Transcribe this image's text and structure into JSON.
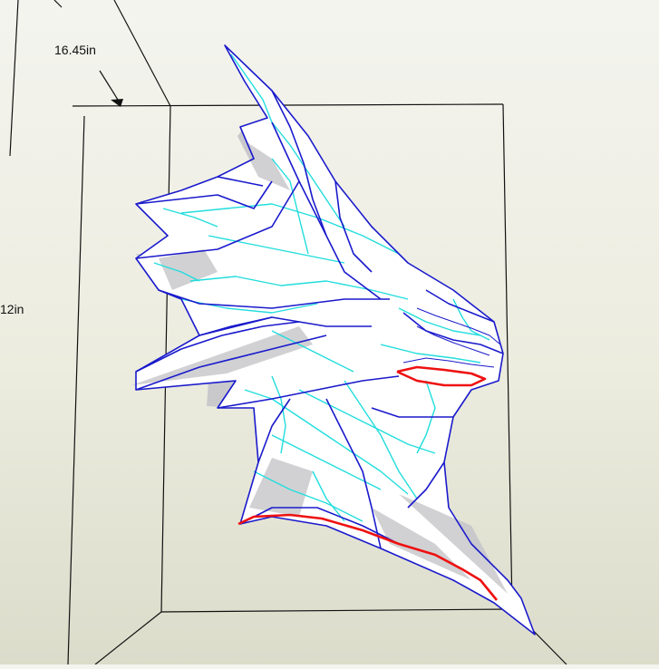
{
  "viewport": {
    "dimensions": {
      "width_label": "16.45in",
      "height_label": "12in"
    },
    "colors": {
      "background_top": "#f4f4ef",
      "background_bottom": "#dcdccb",
      "frame_line": "#111111",
      "mountain_fold": "#1a1acc",
      "valley_fold": "#22dddd",
      "cut_edge": "#ee1111",
      "face_fill": "#ffffff",
      "shade_fill": "#c9c9cc"
    },
    "model": {
      "name_icon": "dragon-head-mesh-icon"
    }
  }
}
